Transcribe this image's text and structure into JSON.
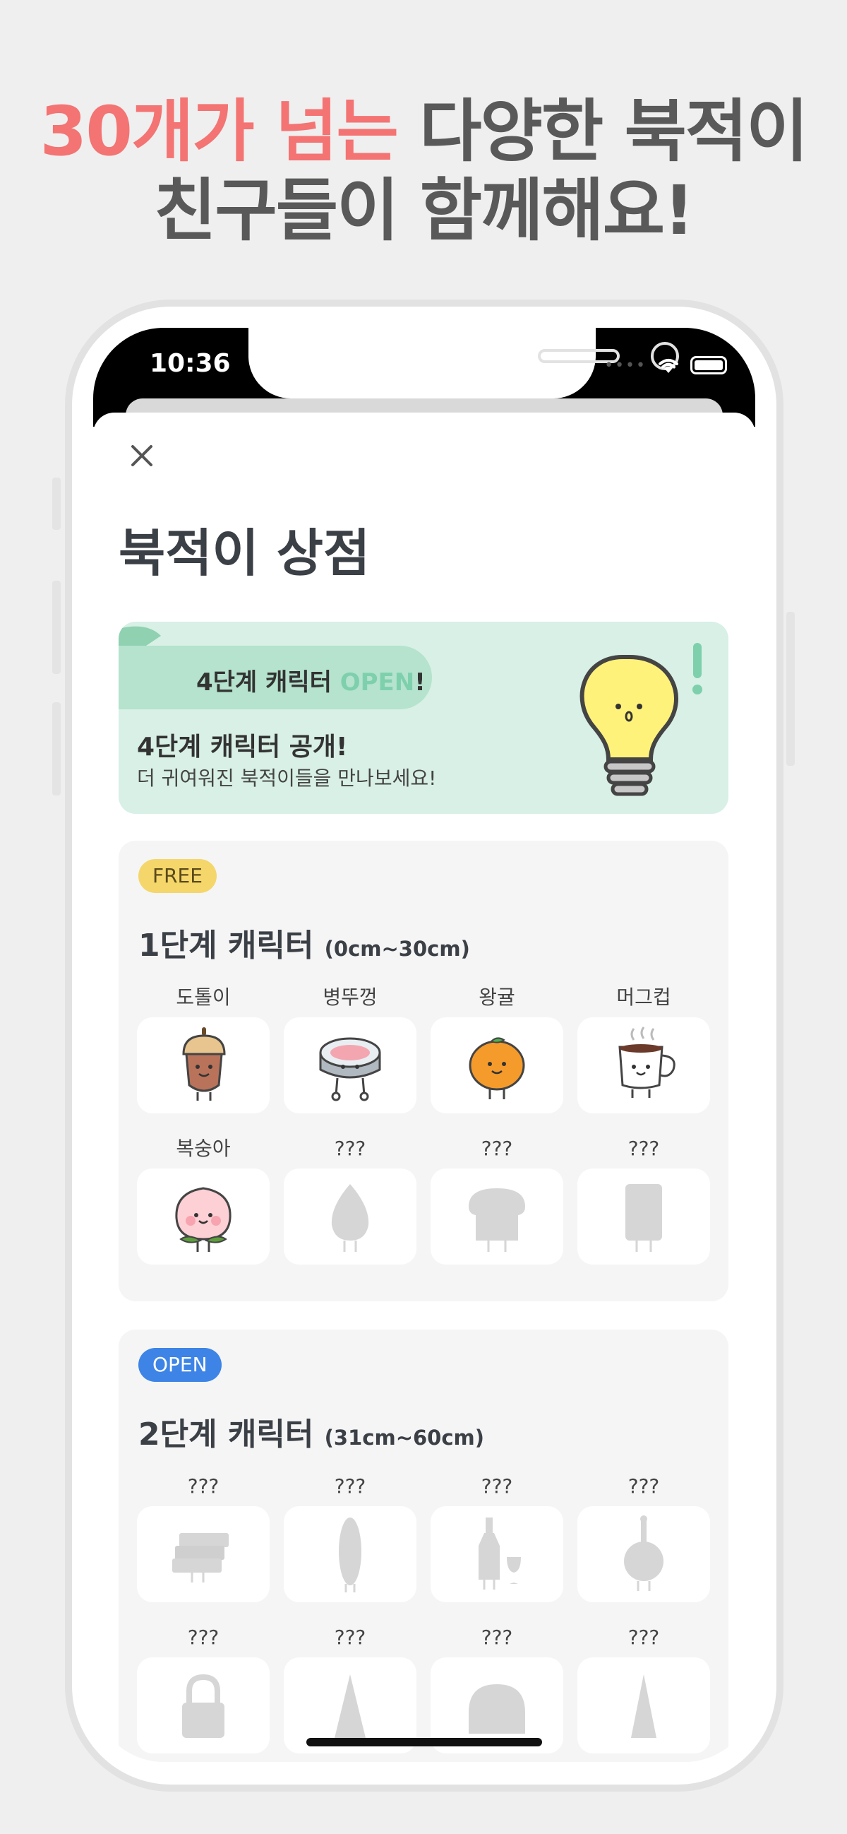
{
  "headline": {
    "line1_accent": "30개가 넘는",
    "line1_rest": " 다양한 북적이",
    "line2": "친구들이 함께해요!"
  },
  "status_bar": {
    "time": "10:36",
    "dots": "••••"
  },
  "shop": {
    "title": "북적이 상점",
    "close_icon": "close-icon"
  },
  "banner": {
    "pill_text_prefix": "4단계 캐릭터 ",
    "pill_text_open": "OPEN",
    "pill_text_suffix": "!",
    "title": "4단계 캐릭터 공개!",
    "subtitle": "더 귀여워진 북적이들을 만나보세요!"
  },
  "sections": [
    {
      "badge": "FREE",
      "title": "1단계 캐릭터",
      "range": "(0cm~30cm)",
      "items": [
        {
          "name": "도톨이",
          "icon": "acorn-character-icon"
        },
        {
          "name": "병뚜껑",
          "icon": "bottle-cap-character-icon"
        },
        {
          "name": "왕귤",
          "icon": "tangerine-character-icon"
        },
        {
          "name": "머그컵",
          "icon": "mug-character-icon"
        },
        {
          "name": "복숭아",
          "icon": "peach-character-icon"
        },
        {
          "name": "???",
          "icon": "locked-leaf-silhouette-icon"
        },
        {
          "name": "???",
          "icon": "locked-bread-silhouette-icon"
        },
        {
          "name": "???",
          "icon": "locked-rectangle-silhouette-icon"
        }
      ]
    },
    {
      "badge": "OPEN",
      "title": "2단계 캐릭터",
      "range": "(31cm~60cm)",
      "items": [
        {
          "name": "???",
          "icon": "locked-books-silhouette-icon"
        },
        {
          "name": "???",
          "icon": "locked-surfboard-silhouette-icon"
        },
        {
          "name": "???",
          "icon": "locked-wine-silhouette-icon"
        },
        {
          "name": "???",
          "icon": "locked-pan-silhouette-icon"
        },
        {
          "name": "???",
          "icon": "locked-bag-silhouette-icon"
        },
        {
          "name": "???",
          "icon": "locked-cone-silhouette-icon"
        },
        {
          "name": "???",
          "icon": "locked-dome-silhouette-icon"
        },
        {
          "name": "???",
          "icon": "locked-cone-silhouette-icon"
        }
      ]
    }
  ],
  "colors": {
    "accent": "#f47373",
    "banner_bg": "#d8f0e5",
    "free_badge": "#f4d66b",
    "open_badge": "#3d84e6"
  }
}
